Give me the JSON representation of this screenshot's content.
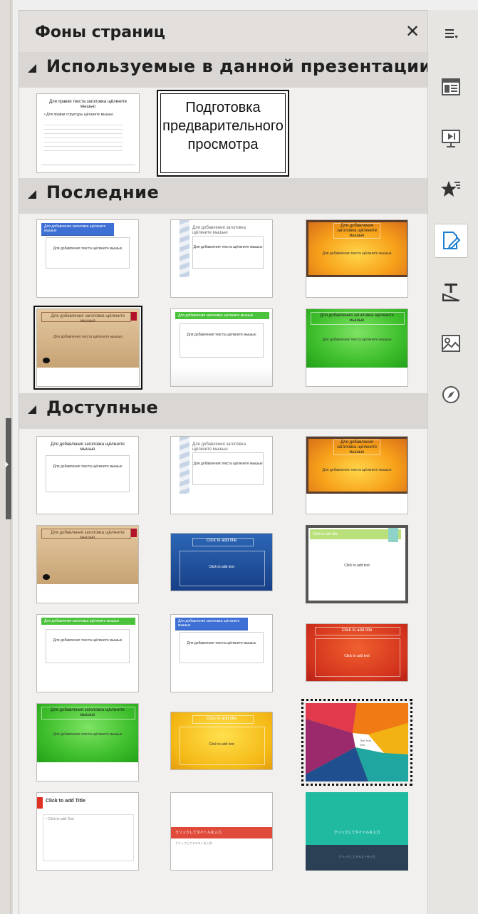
{
  "panel": {
    "title": "Фоны страниц",
    "close_label": "✕"
  },
  "sections": {
    "used": {
      "title": "Используемые в данной презентации",
      "items": [
        {
          "name": "used-master-1",
          "title": "Для правки текста заголовка щёлкните мышью",
          "body": "• Для правки структуры щёлкните мышью"
        },
        {
          "name": "used-preview",
          "preview_text": "Подготовка предварительного просмотра"
        }
      ]
    },
    "recent": {
      "title": "Последние",
      "items": [
        {
          "title": "Для добавления заголовка щёлкните мышью",
          "body": "Для добавления текста щёлкните мышью"
        },
        {
          "title": "Для добавления заголовка щёлкните мышью",
          "body": "Для добавления текста щёлкните мышью"
        },
        {
          "title": "Для добавления заголовка щёлкните мышью",
          "body": "Для добавления текста щёлкните мышью"
        },
        {
          "title": "Для добавления заголовка щёлкните мышью",
          "body": "Для добавления текста щёлкните мышью"
        },
        {
          "title": "Для добавления заголовка щёлкните мышью",
          "body": "Для добавления текста щёлкните мышью"
        },
        {
          "title": "Для добавления заголовка щёлкните мышью",
          "body": "Для добавления текста щёлкните мышью"
        }
      ]
    },
    "available": {
      "title": "Доступные",
      "items": [
        {
          "title": "Для добавления заголовка щёлкните мышью",
          "body": "Для добавления текста щёлкните мышью"
        },
        {
          "title": "Для добавления заголовка щёлкните мышью",
          "body": "Для добавления текста щёлкните мышью"
        },
        {
          "title": "Для добавления заголовка щёлкните мышью",
          "body": "Для добавления текста щёлкните мышью"
        },
        {
          "title": "Для добавления заголовка щёлкните мышью",
          "body": "Для добавления текста щёлкните мышью"
        },
        {
          "title": "Click to add title",
          "body": "Click to add text"
        },
        {
          "title": "Click to add title",
          "body": "Click to add text"
        },
        {
          "title": "Для добавления заголовка щёлкните мышью",
          "body": "Для добавления текста щёлкните мышью"
        },
        {
          "title": "Для добавления заголовка щёлкните мышью",
          "body": "Для добавления текста щёлкните мышью"
        },
        {
          "title": "Click to add title",
          "body": "Click to add text"
        },
        {
          "title": "Для добавления заголовка щёлкните мышью",
          "body": "Для добавления текста щёлкните мышью"
        },
        {
          "title": "Click to add title",
          "body": "Click to add text"
        },
        {
          "title": "",
          "body": "Text Text Text"
        },
        {
          "title": "Click to add Title",
          "body": "• Click to add Text"
        },
        {
          "title": "クリックしてタイトルを入力",
          "body": "クリックしてテキストを入力"
        },
        {
          "title": "クリックしてタイトルを入力",
          "body": "クリックしてテキストを入力"
        }
      ]
    }
  },
  "sidebar": {
    "menu_icon": "hamburger-menu-icon",
    "buttons": [
      {
        "name": "properties-icon",
        "glyph": "▤"
      },
      {
        "name": "slide-transition-icon",
        "glyph": "▶"
      },
      {
        "name": "animation-star-icon",
        "glyph": "★"
      },
      {
        "name": "master-slides-icon",
        "glyph": "✎",
        "active": true
      },
      {
        "name": "styles-icon",
        "glyph": "T"
      },
      {
        "name": "gallery-icon",
        "glyph": "▨"
      },
      {
        "name": "navigator-icon",
        "glyph": "⊘"
      }
    ]
  },
  "colors": {
    "accent_blue": "#3d6fd4",
    "orange": "#f7a11a",
    "green": "#3fbf2c",
    "red": "#d2331d",
    "teal": "#1fbaa0"
  }
}
